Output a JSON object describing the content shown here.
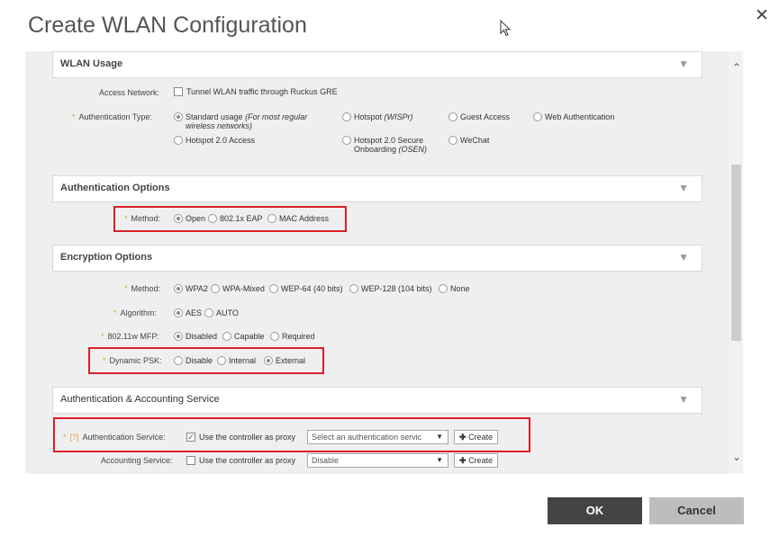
{
  "dialog": {
    "title": "Create WLAN Configuration"
  },
  "sections": {
    "wlan_usage": "WLAN Usage",
    "auth_options": "Authentication Options",
    "encryption_options": "Encryption Options",
    "auth_accounting": "Authentication & Accounting Service"
  },
  "wlan_usage": {
    "access_network_label": "Access Network:",
    "access_network_option": "Tunnel WLAN traffic through Ruckus GRE",
    "auth_type_label": "Authentication Type:",
    "auth_types": {
      "standard": "Standard usage ",
      "standard_note": "(For most regular wireless networks)",
      "hotspot": "Hotspot ",
      "hotspot_note": "(WISPr)",
      "guest": "Guest Access",
      "web": "Web Authentication",
      "hotspot20": "Hotspot 2.0 Access",
      "hotspot20_secure": "Hotspot 2.0 Secure",
      "hotspot20_secure_line2": "Onboarding ",
      "hotspot20_secure_note": "(OSEN)",
      "wechat": "WeChat"
    }
  },
  "auth_options": {
    "method_label": "Method:",
    "methods": [
      "Open",
      "802.1x EAP",
      "MAC Address"
    ],
    "selected": "Open"
  },
  "encryption": {
    "method_label": "Method:",
    "methods": [
      "WPA2",
      "WPA-Mixed",
      "WEP-64 (40 bits)",
      "WEP-128 (104 bits)",
      "None"
    ],
    "algorithm_label": "Algorithm:",
    "algorithms": [
      "AES",
      "AUTO"
    ],
    "mfp_label": "802.11w MFP:",
    "mfp_options": [
      "Disabled",
      "Capable",
      "Required"
    ],
    "dpsk_label": "Dynamic PSK:",
    "dpsk_options": [
      "Disable",
      "Internal",
      "External"
    ]
  },
  "aaa": {
    "help_link": "[?]",
    "auth_service_label": "Authentication Service:",
    "auth_use_controller": "Use the controller as proxy",
    "auth_select_placeholder": "Select an authentication servic",
    "create_label": "Create",
    "acct_service_label": "Accounting Service:",
    "acct_use_controller": "Use the controller as proxy",
    "acct_select_value": "Disable"
  },
  "footer": {
    "ok": "OK",
    "cancel": "Cancel"
  },
  "icons": {
    "close": "close-icon",
    "cursor": "mouse-pointer-icon",
    "collapse": "triangle-down-icon",
    "add": "plus-icon"
  }
}
